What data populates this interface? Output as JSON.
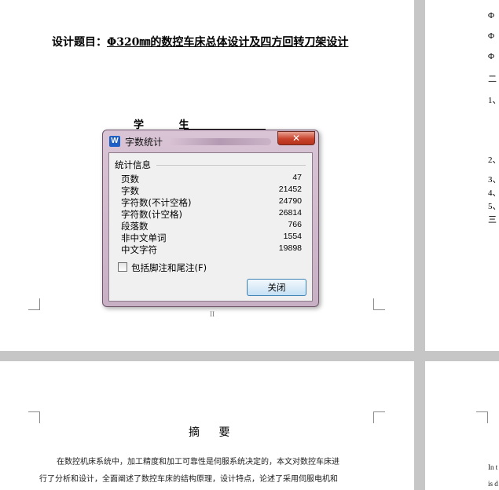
{
  "document": {
    "title_prefix": "设计题目：",
    "title": "Φ320㎜的数控车床总体设计及四方回转刀架设计",
    "student_label": "学 生",
    "page_number": "II",
    "toc_items": [
      "Φ",
      "Φ",
      "Φ",
      "二",
      "1、",
      "2、",
      "3、",
      "4、",
      "5、",
      "三"
    ],
    "abstract_title": "摘 要",
    "abstract_lines": [
      "在数控机床系统中，加工精度和加工可靠性是伺服系统决定的，本文对数控车床进",
      "行了分析和设计，全面阐述了数控车床的结构原理，设计特点，论述了采用伺服电机和"
    ],
    "english_lines": [
      "In t",
      "is d"
    ]
  },
  "dialog": {
    "title": "字数统计",
    "app_icon": "W",
    "close_glyph": "✕",
    "group_label": "统计信息",
    "stats": [
      {
        "label": "页数",
        "value": "47"
      },
      {
        "label": "字数",
        "value": "21452"
      },
      {
        "label": "字符数(不计空格)",
        "value": "24790"
      },
      {
        "label": "字符数(计空格)",
        "value": "26814"
      },
      {
        "label": "段落数",
        "value": "766"
      },
      {
        "label": "非中文单词",
        "value": "1554"
      },
      {
        "label": "中文字符",
        "value": "19898"
      }
    ],
    "include_notes_label": "包括脚注和尾注(F)",
    "include_notes_checked": false,
    "close_button": "关闭"
  },
  "colors": {
    "accent": "#1d5fc4",
    "close_red": "#c8432c",
    "frame": "#d9c4d5"
  }
}
